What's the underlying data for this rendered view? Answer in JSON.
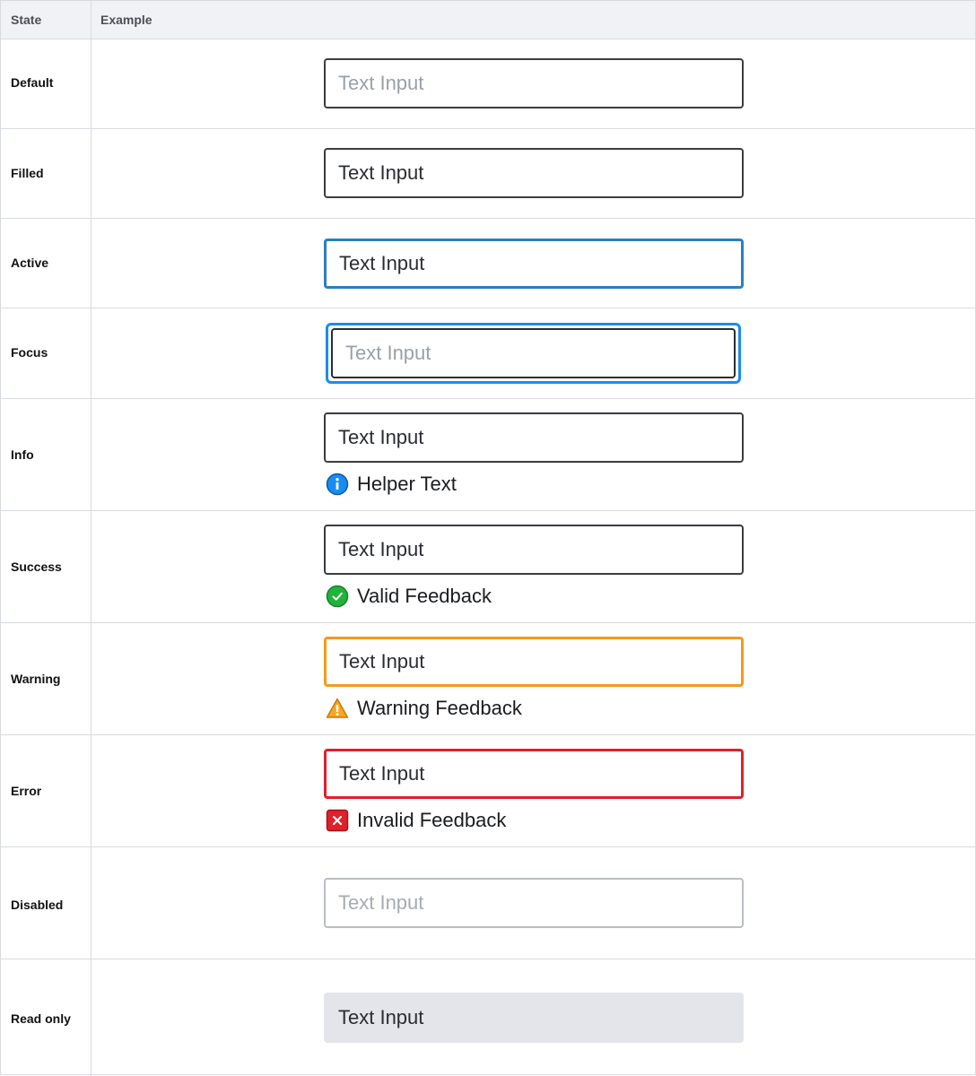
{
  "header": {
    "state_label": "State",
    "example_label": "Example"
  },
  "rows": [
    {
      "state": "Default",
      "input_text": "Text Input"
    },
    {
      "state": "Filled",
      "input_text": "Text Input"
    },
    {
      "state": "Active",
      "input_text": "Text Input"
    },
    {
      "state": "Focus",
      "input_text": "Text Input"
    },
    {
      "state": "Info",
      "input_text": "Text Input",
      "feedback": "Helper Text",
      "feedback_icon": "info-icon"
    },
    {
      "state": "Success",
      "input_text": "Text Input",
      "feedback": "Valid Feedback",
      "feedback_icon": "check-circle-icon"
    },
    {
      "state": "Warning",
      "input_text": "Text Input",
      "feedback": "Warning Feedback",
      "feedback_icon": "warning-triangle-icon"
    },
    {
      "state": "Error",
      "input_text": "Text Input",
      "feedback": "Invalid Feedback",
      "feedback_icon": "error-x-icon"
    },
    {
      "state": "Disabled",
      "input_text": "Text Input"
    },
    {
      "state": "Read only",
      "input_text": "Text Input"
    }
  ],
  "colors": {
    "active": "#2b7fbf",
    "focus_ring": "#1a8cf0",
    "info": "#1a8cf0",
    "success": "#22b33a",
    "warning": "#f39a1c",
    "error": "#e0202b",
    "readonly_bg": "#e3e5ea"
  }
}
